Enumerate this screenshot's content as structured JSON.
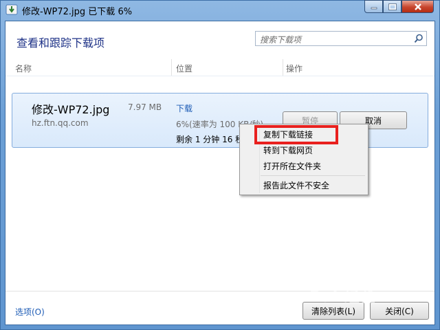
{
  "window": {
    "title": "修改-WP72.jpg 已下载 6%"
  },
  "header": {
    "heading": "查看和跟踪下载项",
    "search_placeholder": "搜索下载项"
  },
  "columns": [
    "名称",
    "位置",
    "操作"
  ],
  "download": {
    "filename": "修改-WP72.jpg",
    "size": "7.97 MB",
    "source": "hz.ftn.qq.com",
    "location_link": "下载",
    "progress": "6%(速率为 100 KB/秒)",
    "progress_fraction": 0.06,
    "remaining": "剩余 1 分钟 16 秒",
    "pause_label": "暂停",
    "cancel_label": "取消"
  },
  "context_menu": {
    "items": [
      "复制下载链接",
      "转到下载网页",
      "打开所在文件夹",
      "报告此文件不安全"
    ],
    "highlighted": "复制下载链接",
    "highlight_color": "#e8201e"
  },
  "footer": {
    "options": "选项(O)",
    "clear_list": "清除列表(L)",
    "close": "关闭(C)"
  },
  "watermark": "Bai 经验"
}
